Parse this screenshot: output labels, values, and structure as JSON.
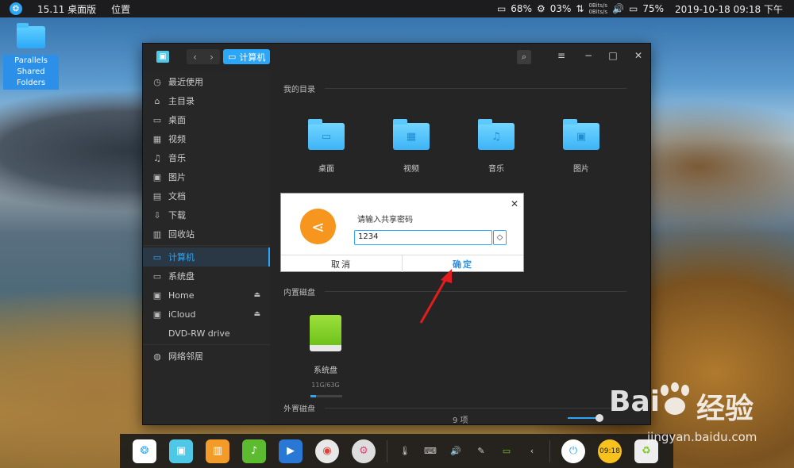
{
  "topbar": {
    "version": "15.11 桌面版",
    "position": "位置",
    "disk": "68%",
    "cpu": "03%",
    "net_up": "0Bits/s",
    "net_down": "0Bits/s",
    "battery": "75%",
    "datetime": "2019-10-18 09:18 下午"
  },
  "desktop": {
    "icon_label": "Parallels Shared Folders"
  },
  "window": {
    "breadcrumb": "计算机",
    "sidebar": [
      {
        "label": "最近使用",
        "icon": "clock-icon"
      },
      {
        "label": "主目录",
        "icon": "home-icon"
      },
      {
        "label": "桌面",
        "icon": "desktop-icon"
      },
      {
        "label": "视频",
        "icon": "video-icon"
      },
      {
        "label": "音乐",
        "icon": "music-icon"
      },
      {
        "label": "图片",
        "icon": "picture-icon"
      },
      {
        "label": "文档",
        "icon": "document-icon"
      },
      {
        "label": "下载",
        "icon": "download-icon"
      },
      {
        "label": "回收站",
        "icon": "trash-icon"
      },
      {
        "label": "计算机",
        "icon": "computer-icon"
      },
      {
        "label": "系统盘",
        "icon": "disk-icon"
      },
      {
        "label": "Home",
        "icon": "drive-icon"
      },
      {
        "label": "iCloud",
        "icon": "drive-icon"
      },
      {
        "label": "DVD-RW drive",
        "icon": ""
      },
      {
        "label": "网络邻居",
        "icon": "network-icon"
      }
    ],
    "sections": {
      "my_dirs": "我的目录",
      "internal_disks": "内置磁盘",
      "external_disks": "外置磁盘"
    },
    "folders": [
      "桌面",
      "视频",
      "音乐",
      "图片"
    ],
    "disk": {
      "label": "系统盘",
      "size": "11G/63G",
      "used_fraction": 0.17
    },
    "status": {
      "count": "9 项"
    }
  },
  "dialog": {
    "prompt": "请输入共享密码",
    "value": "1234",
    "cancel": "取消",
    "ok": "确定"
  },
  "watermark": {
    "brand": "Bai",
    "brand2": "经验",
    "url": "jingyan.baidu.com"
  },
  "dock_clock": "09:18",
  "colors": {
    "accent": "#2ca7f8",
    "dialog_icon": "#f7961e",
    "disk": "#7cc922"
  }
}
